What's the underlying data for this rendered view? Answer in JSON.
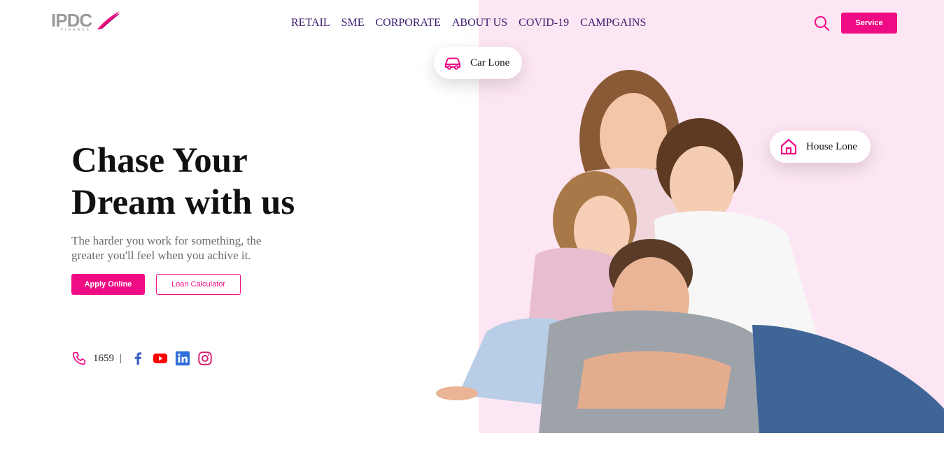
{
  "brand": {
    "logo_text": "IPDC",
    "logo_sub": "FINANCE",
    "accent": "#ef0b84",
    "nav_color": "#3d1a6e",
    "hero_bg": "#fde6f3"
  },
  "nav": {
    "items": [
      "RETAIL",
      "SME",
      "CORPORATE",
      "ABOUT US",
      "COVID-19",
      "CAMPGAINS"
    ]
  },
  "header": {
    "search_icon": "search-icon",
    "service_label": "Service"
  },
  "hero": {
    "title_line1": "Chase Your",
    "title_line2": "Dream with us",
    "subtitle": "The harder you work for something, the greater you'll feel when you achive it.",
    "apply_label": "Apply Online",
    "calculator_label": "Loan Calculator"
  },
  "contact": {
    "phone": "1659",
    "separator": "|",
    "socials": [
      "facebook-icon",
      "youtube-icon",
      "linkedin-icon",
      "instagram-icon"
    ]
  },
  "bubbles": {
    "car_label": "Car Lone",
    "house_label": "House Lone"
  },
  "image": {
    "subject": "family-photo"
  }
}
